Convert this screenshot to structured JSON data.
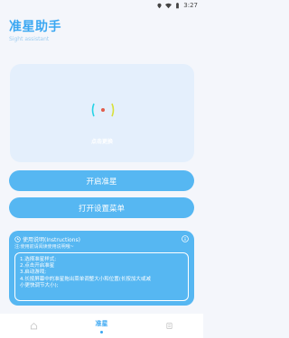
{
  "status_bar": {
    "time": "3:27",
    "icons": [
      "location-icon",
      "wifi-icon",
      "battery-icon"
    ]
  },
  "header": {
    "title": "准星助手",
    "subtitle": "Sight assistant"
  },
  "preview": {
    "caption": "点击更换"
  },
  "buttons": {
    "start": "开启准星",
    "menu": "打开设置菜单"
  },
  "instructions": {
    "title": "使用说明(Instructions)",
    "subtitle": "注:使用前请阅读使用说明哦~",
    "lines": [
      "1.选择准星样式;",
      "2.点击开启准星",
      "3.启动游戏;",
      "4.长按屏幕中的准星拖出菜单调整大小和位置(长按加大或减",
      "小更快调节大小);"
    ]
  },
  "bottom_nav": {
    "items": [
      {
        "icon": "home-icon",
        "label": "",
        "active": false
      },
      {
        "icon": "",
        "label": "准星",
        "active": true
      },
      {
        "icon": "profile-icon",
        "label": "",
        "active": false
      }
    ]
  },
  "colors": {
    "accent": "#3aa7f2",
    "button": "#56b7f2",
    "card": "#e4effc",
    "background": "#f4f6fb"
  }
}
